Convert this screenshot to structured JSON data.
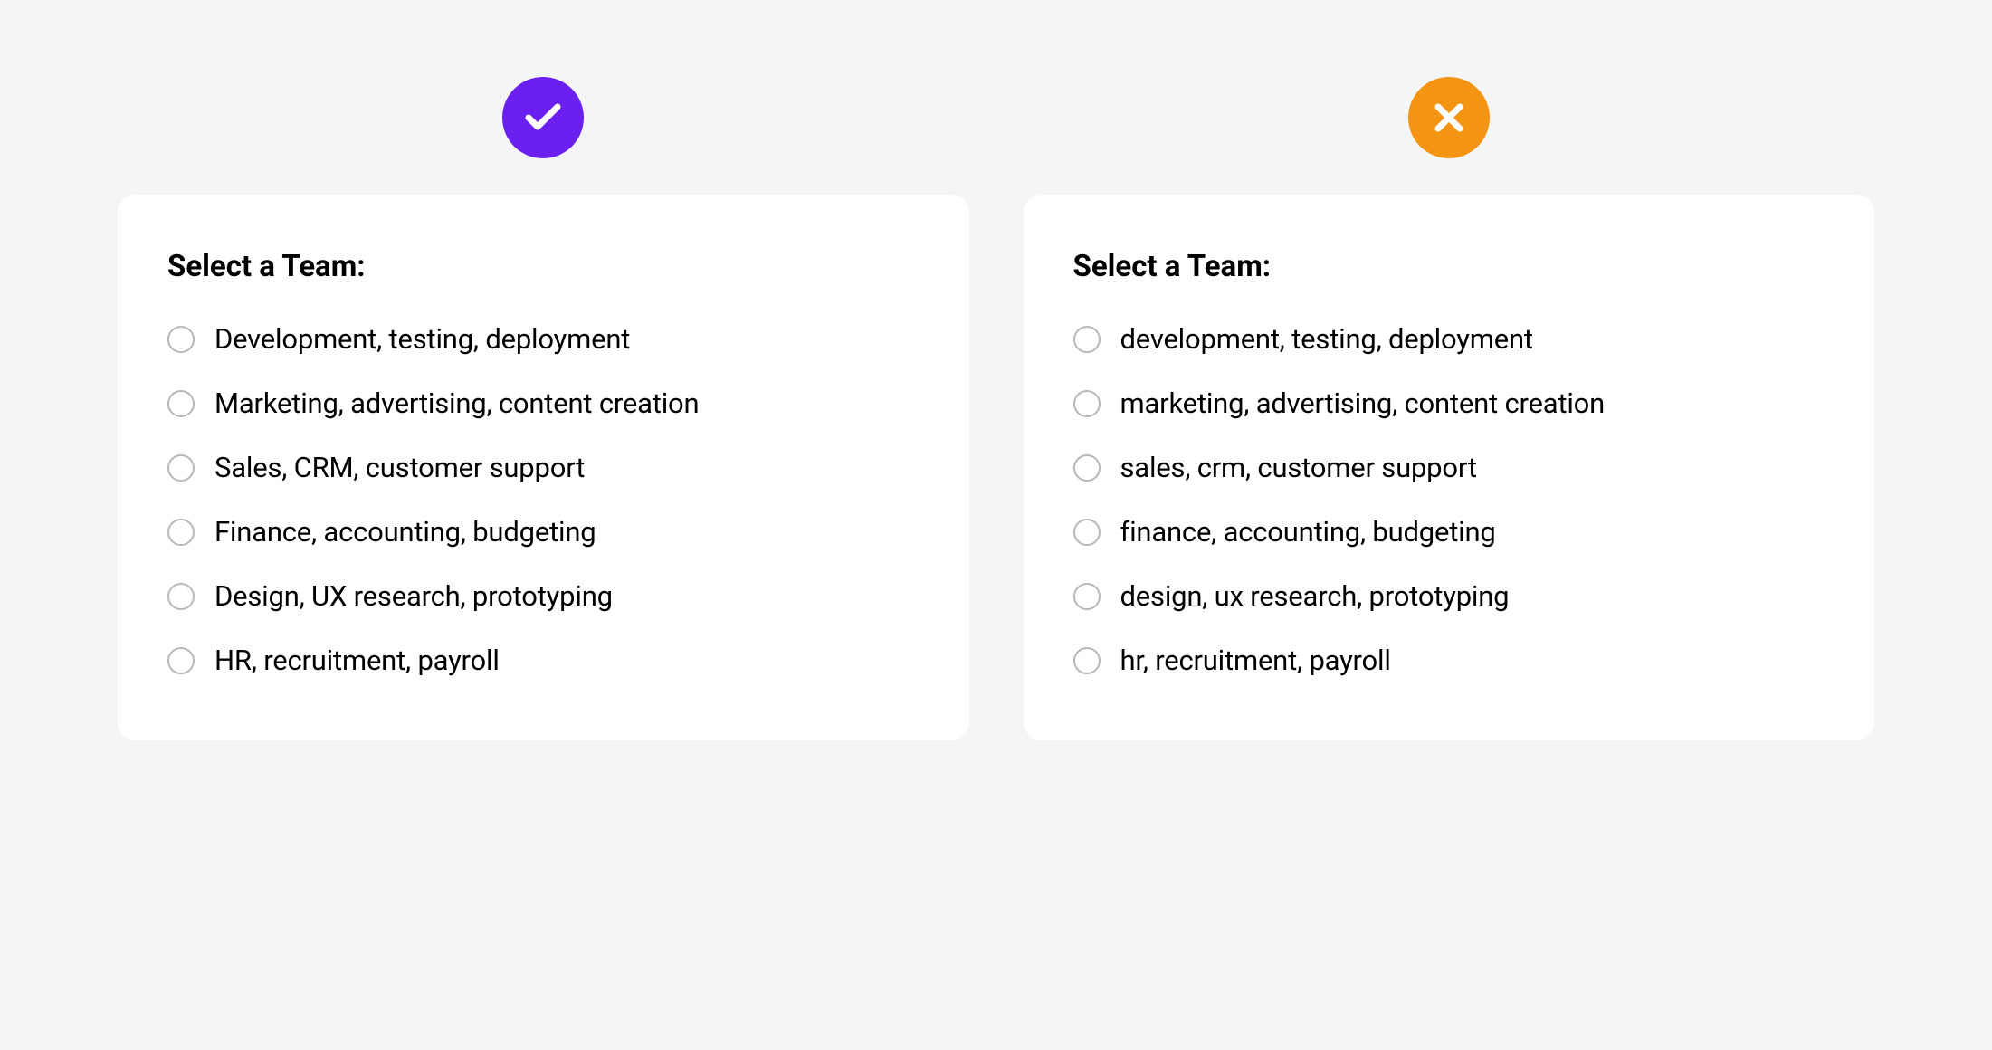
{
  "colors": {
    "correct_badge": "#6b1fef",
    "incorrect_badge": "#f39413",
    "card_bg": "#ffffff",
    "page_bg": "#f4f5f7",
    "radio_border": "#b8b8b8"
  },
  "correct_example": {
    "badge_icon": "check-icon",
    "title": "Select a Team:",
    "options": [
      "Development, testing, deployment",
      "Marketing, advertising, content creation",
      "Sales, CRM, customer support",
      "Finance, accounting, budgeting",
      "Design, UX research, prototyping",
      "HR, recruitment, payroll"
    ]
  },
  "incorrect_example": {
    "badge_icon": "cross-icon",
    "title": "Select a Team:",
    "options": [
      "development, testing, deployment",
      "marketing, advertising, content creation",
      "sales, crm, customer support",
      "finance, accounting, budgeting",
      "design, ux research, prototyping",
      "hr, recruitment, payroll"
    ]
  }
}
